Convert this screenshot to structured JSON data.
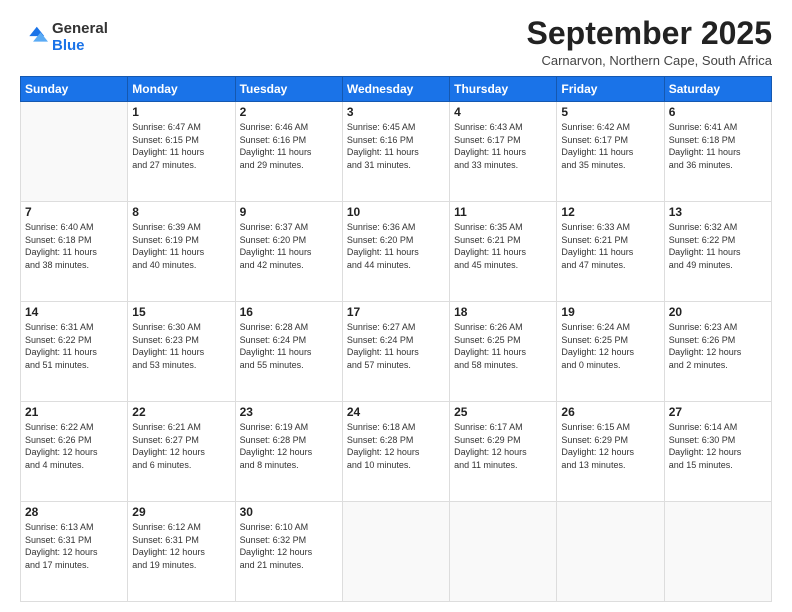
{
  "logo": {
    "line1": "General",
    "line2": "Blue"
  },
  "title": "September 2025",
  "subtitle": "Carnarvon, Northern Cape, South Africa",
  "weekdays": [
    "Sunday",
    "Monday",
    "Tuesday",
    "Wednesday",
    "Thursday",
    "Friday",
    "Saturday"
  ],
  "weeks": [
    [
      {
        "day": "",
        "info": ""
      },
      {
        "day": "1",
        "info": "Sunrise: 6:47 AM\nSunset: 6:15 PM\nDaylight: 11 hours\nand 27 minutes."
      },
      {
        "day": "2",
        "info": "Sunrise: 6:46 AM\nSunset: 6:16 PM\nDaylight: 11 hours\nand 29 minutes."
      },
      {
        "day": "3",
        "info": "Sunrise: 6:45 AM\nSunset: 6:16 PM\nDaylight: 11 hours\nand 31 minutes."
      },
      {
        "day": "4",
        "info": "Sunrise: 6:43 AM\nSunset: 6:17 PM\nDaylight: 11 hours\nand 33 minutes."
      },
      {
        "day": "5",
        "info": "Sunrise: 6:42 AM\nSunset: 6:17 PM\nDaylight: 11 hours\nand 35 minutes."
      },
      {
        "day": "6",
        "info": "Sunrise: 6:41 AM\nSunset: 6:18 PM\nDaylight: 11 hours\nand 36 minutes."
      }
    ],
    [
      {
        "day": "7",
        "info": "Sunrise: 6:40 AM\nSunset: 6:18 PM\nDaylight: 11 hours\nand 38 minutes."
      },
      {
        "day": "8",
        "info": "Sunrise: 6:39 AM\nSunset: 6:19 PM\nDaylight: 11 hours\nand 40 minutes."
      },
      {
        "day": "9",
        "info": "Sunrise: 6:37 AM\nSunset: 6:20 PM\nDaylight: 11 hours\nand 42 minutes."
      },
      {
        "day": "10",
        "info": "Sunrise: 6:36 AM\nSunset: 6:20 PM\nDaylight: 11 hours\nand 44 minutes."
      },
      {
        "day": "11",
        "info": "Sunrise: 6:35 AM\nSunset: 6:21 PM\nDaylight: 11 hours\nand 45 minutes."
      },
      {
        "day": "12",
        "info": "Sunrise: 6:33 AM\nSunset: 6:21 PM\nDaylight: 11 hours\nand 47 minutes."
      },
      {
        "day": "13",
        "info": "Sunrise: 6:32 AM\nSunset: 6:22 PM\nDaylight: 11 hours\nand 49 minutes."
      }
    ],
    [
      {
        "day": "14",
        "info": "Sunrise: 6:31 AM\nSunset: 6:22 PM\nDaylight: 11 hours\nand 51 minutes."
      },
      {
        "day": "15",
        "info": "Sunrise: 6:30 AM\nSunset: 6:23 PM\nDaylight: 11 hours\nand 53 minutes."
      },
      {
        "day": "16",
        "info": "Sunrise: 6:28 AM\nSunset: 6:24 PM\nDaylight: 11 hours\nand 55 minutes."
      },
      {
        "day": "17",
        "info": "Sunrise: 6:27 AM\nSunset: 6:24 PM\nDaylight: 11 hours\nand 57 minutes."
      },
      {
        "day": "18",
        "info": "Sunrise: 6:26 AM\nSunset: 6:25 PM\nDaylight: 11 hours\nand 58 minutes."
      },
      {
        "day": "19",
        "info": "Sunrise: 6:24 AM\nSunset: 6:25 PM\nDaylight: 12 hours\nand 0 minutes."
      },
      {
        "day": "20",
        "info": "Sunrise: 6:23 AM\nSunset: 6:26 PM\nDaylight: 12 hours\nand 2 minutes."
      }
    ],
    [
      {
        "day": "21",
        "info": "Sunrise: 6:22 AM\nSunset: 6:26 PM\nDaylight: 12 hours\nand 4 minutes."
      },
      {
        "day": "22",
        "info": "Sunrise: 6:21 AM\nSunset: 6:27 PM\nDaylight: 12 hours\nand 6 minutes."
      },
      {
        "day": "23",
        "info": "Sunrise: 6:19 AM\nSunset: 6:28 PM\nDaylight: 12 hours\nand 8 minutes."
      },
      {
        "day": "24",
        "info": "Sunrise: 6:18 AM\nSunset: 6:28 PM\nDaylight: 12 hours\nand 10 minutes."
      },
      {
        "day": "25",
        "info": "Sunrise: 6:17 AM\nSunset: 6:29 PM\nDaylight: 12 hours\nand 11 minutes."
      },
      {
        "day": "26",
        "info": "Sunrise: 6:15 AM\nSunset: 6:29 PM\nDaylight: 12 hours\nand 13 minutes."
      },
      {
        "day": "27",
        "info": "Sunrise: 6:14 AM\nSunset: 6:30 PM\nDaylight: 12 hours\nand 15 minutes."
      }
    ],
    [
      {
        "day": "28",
        "info": "Sunrise: 6:13 AM\nSunset: 6:31 PM\nDaylight: 12 hours\nand 17 minutes."
      },
      {
        "day": "29",
        "info": "Sunrise: 6:12 AM\nSunset: 6:31 PM\nDaylight: 12 hours\nand 19 minutes."
      },
      {
        "day": "30",
        "info": "Sunrise: 6:10 AM\nSunset: 6:32 PM\nDaylight: 12 hours\nand 21 minutes."
      },
      {
        "day": "",
        "info": ""
      },
      {
        "day": "",
        "info": ""
      },
      {
        "day": "",
        "info": ""
      },
      {
        "day": "",
        "info": ""
      }
    ]
  ]
}
